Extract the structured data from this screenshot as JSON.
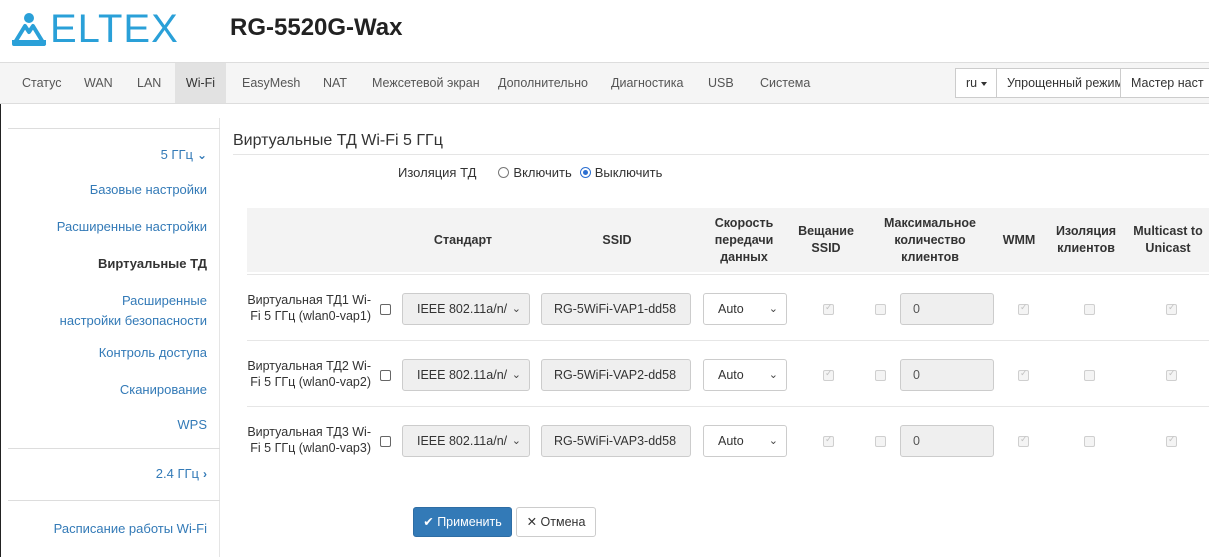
{
  "header": {
    "logo_text": "ELTEX",
    "device_title": "RG-5520G-Wax"
  },
  "nav": {
    "items": [
      "Статус",
      "WAN",
      "LAN",
      "Wi-Fi",
      "EasyMesh",
      "NAT",
      "Межсетевой экран",
      "Дополнительно",
      "Диагностика",
      "USB",
      "Система"
    ],
    "active": "Wi-Fi",
    "lang": "ru",
    "simple_mode": "Упрощенный режим",
    "wizard": "Мастер наст"
  },
  "sidebar": {
    "group_5ghz": "5 ГГц",
    "items": [
      "Базовые настройки",
      "Расширенные настройки",
      "Виртуальные ТД",
      "Расширенные настройки безопасности",
      "Контроль доступа",
      "Сканирование",
      "WPS"
    ],
    "active": "Виртуальные ТД",
    "group_24ghz": "2.4 ГГц",
    "schedule": "Расписание работы Wi-Fi"
  },
  "main": {
    "title": "Виртуальные ТД Wi-Fi 5 ГГц",
    "isolation_label": "Изоляция ТД",
    "isolation_on": "Включить",
    "isolation_off": "Выключить",
    "isolation_value": "Выключить"
  },
  "table": {
    "headers": {
      "standard": "Стандарт",
      "ssid": "SSID",
      "rate": "Скорость передачи данных",
      "broadcast": "Вещание SSID",
      "max_clients": "Максимальное количество клиентов",
      "wmm": "WMM",
      "client_isolation": "Изоляция клиентов",
      "multicast": "Multicast to Unicast"
    },
    "rows": [
      {
        "label": "Виртуальная ТД1 Wi-Fi 5 ГГц (wlan0-vap1)",
        "standard": "IEEE 802.11a/n/",
        "ssid": "RG-5WiFi-VAP1-dd58",
        "rate": "Auto",
        "max_clients": "0"
      },
      {
        "label": "Виртуальная ТД2 Wi-Fi 5 ГГц (wlan0-vap2)",
        "standard": "IEEE 802.11a/n/",
        "ssid": "RG-5WiFi-VAP2-dd58",
        "rate": "Auto",
        "max_clients": "0"
      },
      {
        "label": "Виртуальная ТД3 Wi-Fi 5 ГГц (wlan0-vap3)",
        "standard": "IEEE 802.11a/n/",
        "ssid": "RG-5WiFi-VAP3-dd58",
        "rate": "Auto",
        "max_clients": "0"
      }
    ]
  },
  "buttons": {
    "apply": "Применить",
    "cancel": "Отмена"
  },
  "colors": {
    "brand": "#2aa0d8",
    "link": "#337ab7",
    "primary_button": "#337ab7"
  }
}
